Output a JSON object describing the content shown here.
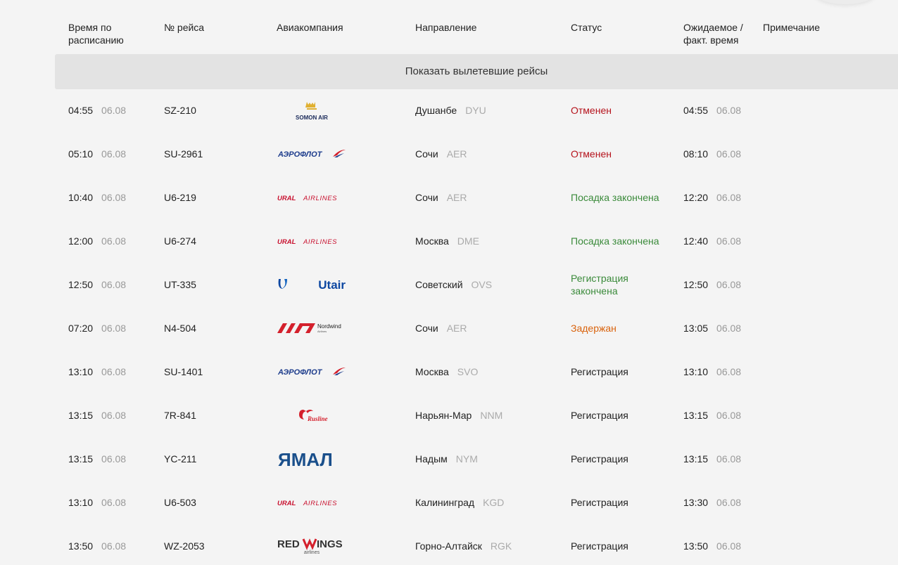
{
  "header": {
    "scheduled": "Время по\nрасписанию",
    "flight_no": "№ рейса",
    "airline": "Авиакомпания",
    "direction": "Направление",
    "status": "Статус",
    "expected": "Ожидаемое /\nфакт. время",
    "note": "Примечание"
  },
  "show_departed_label": "Показать вылетевшие рейсы",
  "flights": [
    {
      "time": "04:55",
      "date": "06.08",
      "flight": "SZ-210",
      "airline_icon": "somon-air-logo",
      "city": "Душанбе",
      "code": "DYU",
      "status": "Отменен",
      "est_time": "04:55",
      "est_date": "06.08"
    },
    {
      "time": "05:10",
      "date": "06.08",
      "flight": "SU-2961",
      "airline_icon": "aeroflot-logo",
      "city": "Сочи",
      "code": "AER",
      "status": "Отменен",
      "est_time": "08:10",
      "est_date": "06.08"
    },
    {
      "time": "10:40",
      "date": "06.08",
      "flight": "U6-219",
      "airline_icon": "ural-airlines-logo",
      "city": "Сочи",
      "code": "AER",
      "status": "Посадка закончена",
      "est_time": "12:20",
      "est_date": "06.08"
    },
    {
      "time": "12:00",
      "date": "06.08",
      "flight": "U6-274",
      "airline_icon": "ural-airlines-logo",
      "city": "Москва",
      "code": "DME",
      "status": "Посадка закончена",
      "est_time": "12:40",
      "est_date": "06.08"
    },
    {
      "time": "12:50",
      "date": "06.08",
      "flight": "UT-335",
      "airline_icon": "utair-logo",
      "city": "Советский",
      "code": "OVS",
      "status": "Регистрация\nзакончена",
      "est_time": "12:50",
      "est_date": "06.08"
    },
    {
      "time": "07:20",
      "date": "06.08",
      "flight": "N4-504",
      "airline_icon": "nordwind-logo",
      "city": "Сочи",
      "code": "AER",
      "status": "Задержан",
      "est_time": "13:05",
      "est_date": "06.08"
    },
    {
      "time": "13:10",
      "date": "06.08",
      "flight": "SU-1401",
      "airline_icon": "aeroflot-logo",
      "city": "Москва",
      "code": "SVO",
      "status": "Регистрация",
      "est_time": "13:10",
      "est_date": "06.08"
    },
    {
      "time": "13:15",
      "date": "06.08",
      "flight": "7R-841",
      "airline_icon": "rusline-logo",
      "city": "Нарьян-Мар",
      "code": "NNM",
      "status": "Регистрация",
      "est_time": "13:15",
      "est_date": "06.08"
    },
    {
      "time": "13:15",
      "date": "06.08",
      "flight": "YC-211",
      "airline_icon": "yamal-logo",
      "city": "Надым",
      "code": "NYM",
      "status": "Регистрация",
      "est_time": "13:15",
      "est_date": "06.08"
    },
    {
      "time": "13:10",
      "date": "06.08",
      "flight": "U6-503",
      "airline_icon": "ural-airlines-logo",
      "city": "Калининград",
      "code": "KGD",
      "status": "Регистрация",
      "est_time": "13:30",
      "est_date": "06.08"
    },
    {
      "time": "13:50",
      "date": "06.08",
      "flight": "WZ-2053",
      "airline_icon": "redwings-logo",
      "city": "Горно-Алтайск",
      "code": "RGK",
      "status": "Регистрация",
      "est_time": "13:50",
      "est_date": "06.08"
    }
  ],
  "logos": {
    "somon_air": "SOMON AIR",
    "aeroflot": "АЭРОФЛОТ",
    "ural_1": "URAL",
    "ural_2": "AIRLINES",
    "utair": "Utair",
    "nordwind_1": "Nordwind",
    "nordwind_2": "Airlines",
    "rusline": "Rusline",
    "yamal": "ЯМАЛ",
    "redwings_1": "RED",
    "redwings_2": "INGS",
    "redwings_3": "airlines"
  },
  "colors": {
    "cancelled": "#b5121b",
    "boarding_closed": "#3a8a3a",
    "delayed": "#d9620c",
    "check_in": "#222222"
  }
}
